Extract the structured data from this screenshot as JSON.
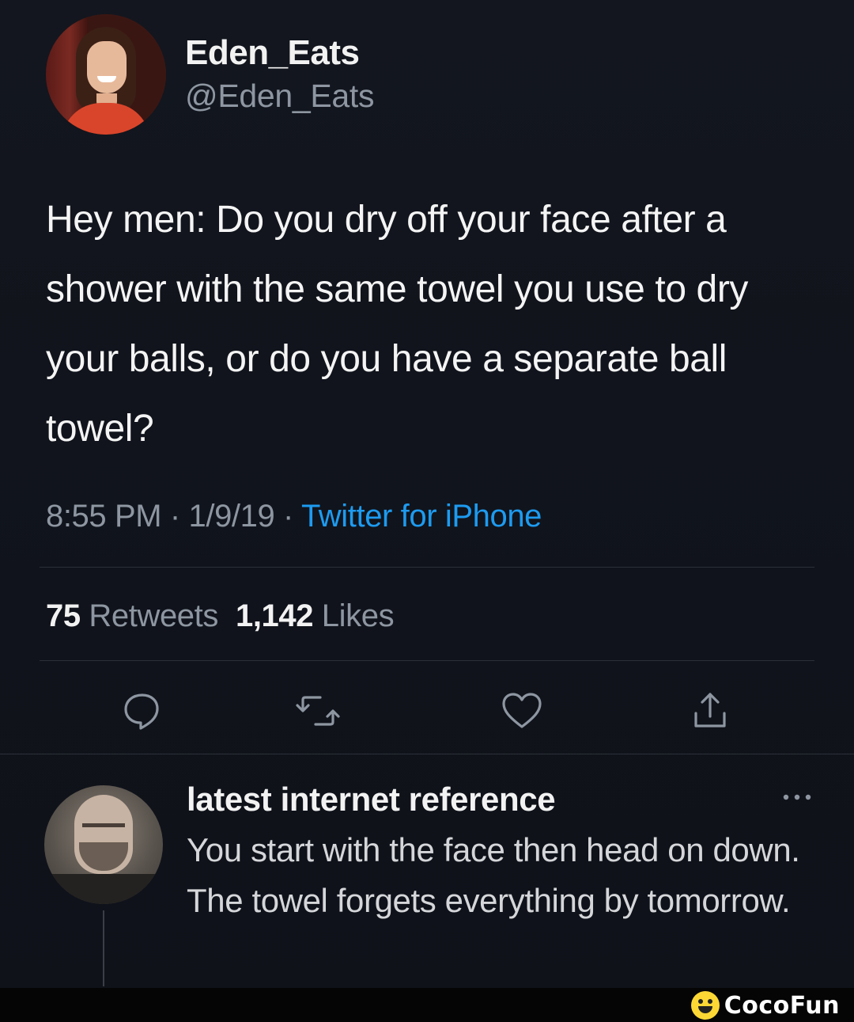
{
  "tweet": {
    "author": {
      "display_name": "Eden_Eats",
      "handle": "@Eden_Eats"
    },
    "text": "Hey men: Do you dry off your face after a shower with the same towel you use to dry your balls, or do you have a separate ball towel?",
    "time": "8:55 PM",
    "separator": " · ",
    "date": "1/9/19",
    "source": "Twitter for iPhone",
    "stats": {
      "retweets_count": "75",
      "retweets_label": "Retweets",
      "likes_count": "1,142",
      "likes_label": "Likes"
    },
    "actions": [
      {
        "icon": "reply-icon"
      },
      {
        "icon": "retweet-icon"
      },
      {
        "icon": "like-icon"
      },
      {
        "icon": "share-icon"
      }
    ]
  },
  "reply": {
    "author_name": "latest internet reference",
    "text": "You start with the face then head on down. The towel forgets everything by tomorrow.",
    "menu_icon": "more-options-icon"
  },
  "watermark": {
    "brand": "CocoFun"
  },
  "colors": {
    "background": "#12151d",
    "primary_text": "#f2f2f2",
    "secondary_text": "#8d96a1",
    "link": "#1d9bf0",
    "divider": "#2b3038"
  }
}
